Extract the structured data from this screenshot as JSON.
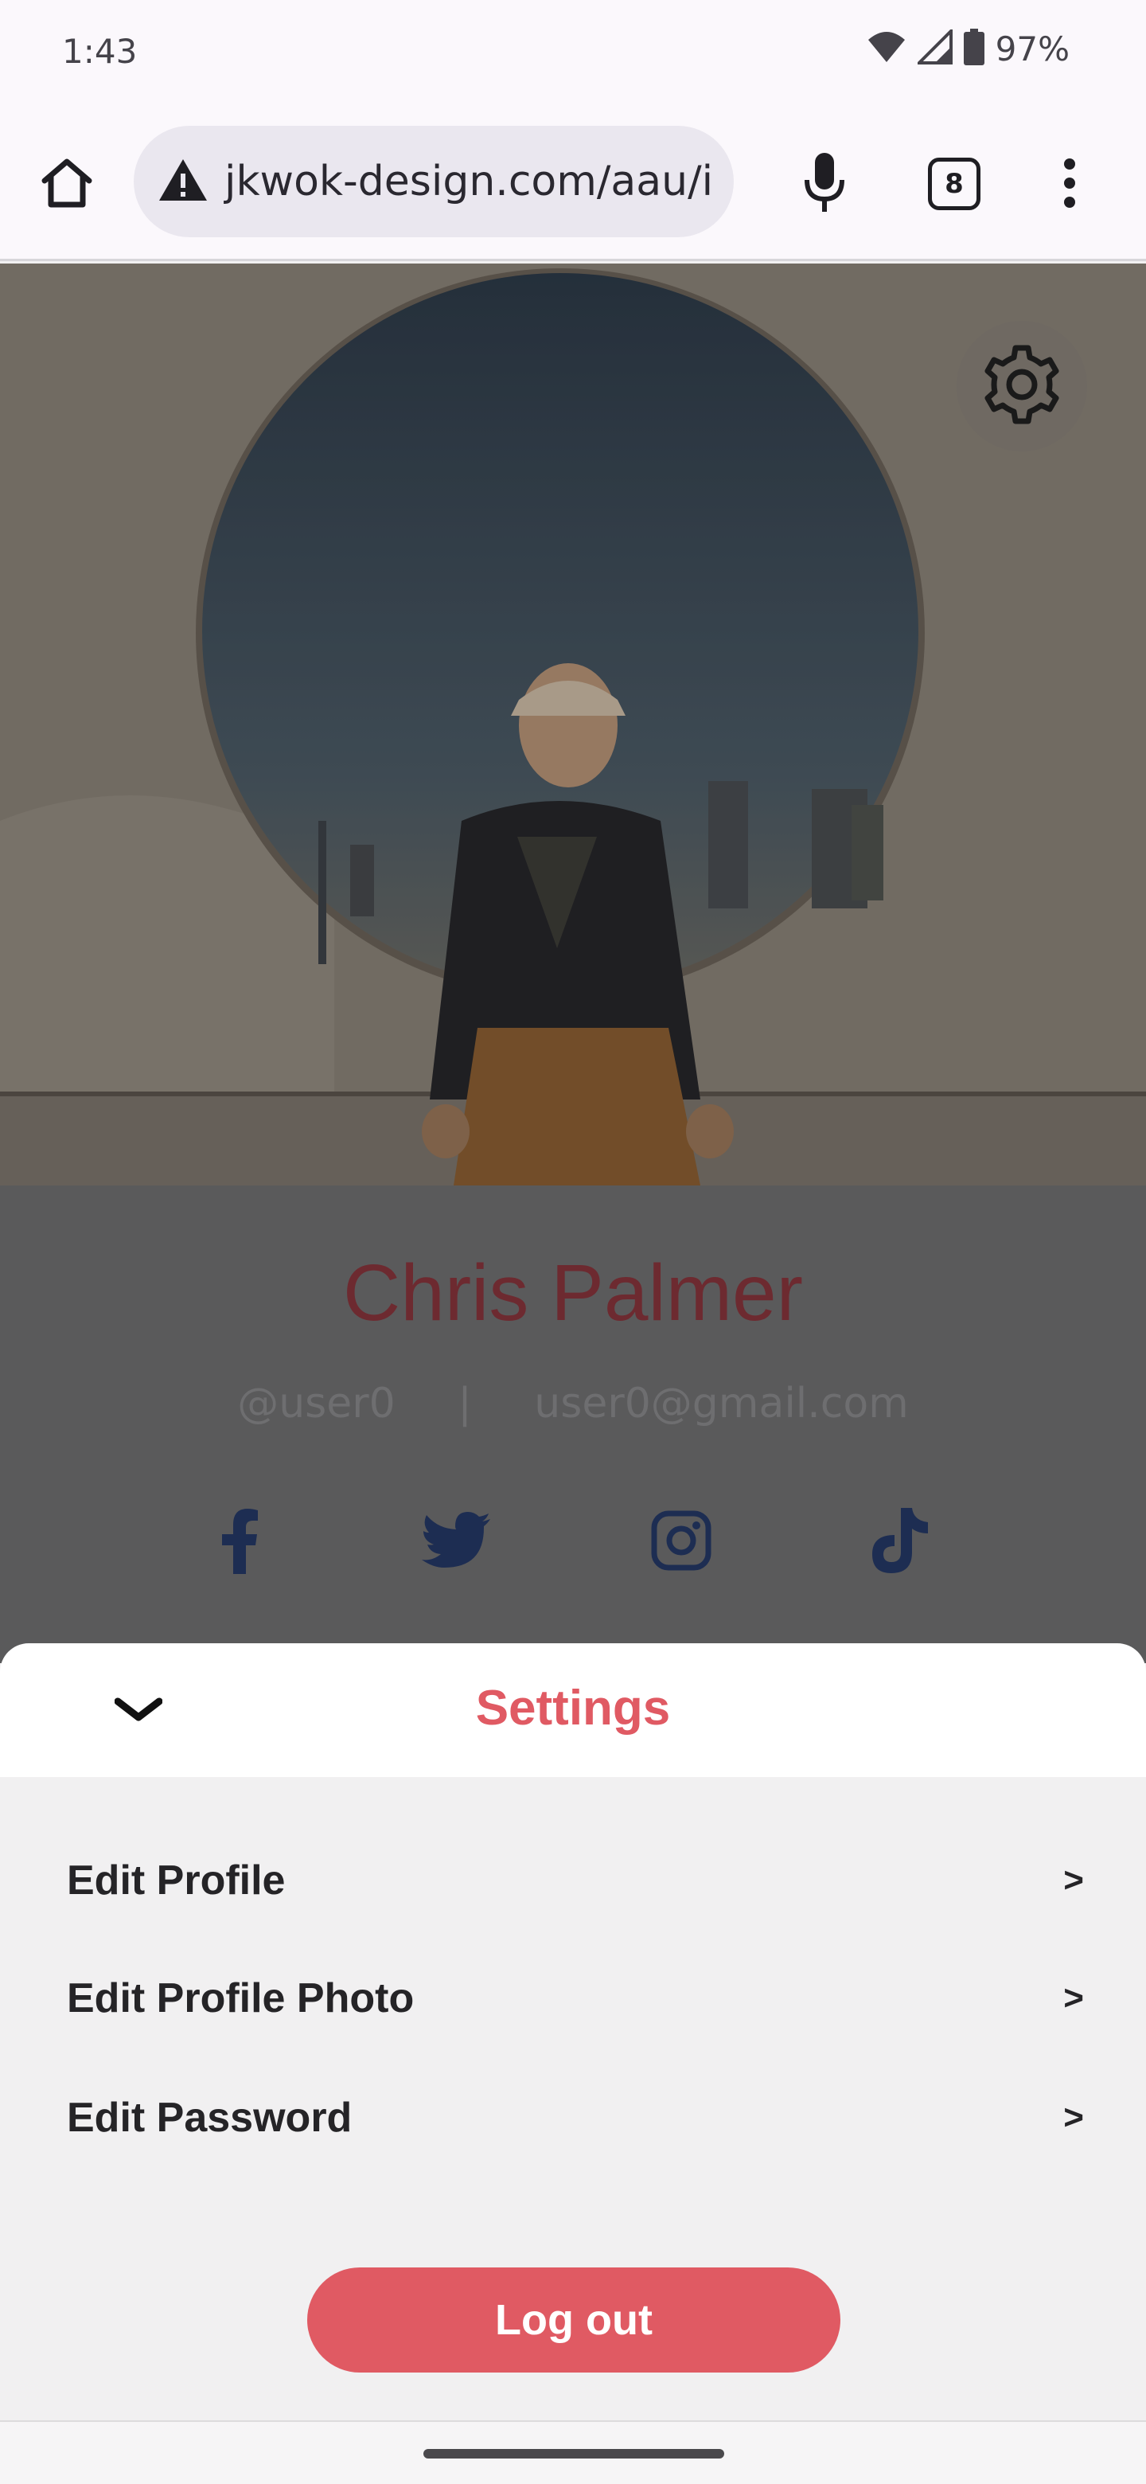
{
  "status_bar": {
    "time": "1:43",
    "battery": "97%",
    "icons": [
      "wifi-icon",
      "cell-signal-icon",
      "battery-icon"
    ]
  },
  "browser": {
    "url": "jkwok-design.com/aau/i",
    "tab_count": "8",
    "icons": [
      "home-icon",
      "warning-icon",
      "mic-icon",
      "tabs-icon",
      "more-vert-icon"
    ]
  },
  "profile": {
    "name": "Chris Palmer",
    "username": "@user0",
    "separator": "|",
    "email": "user0@gmail.com",
    "socials": [
      "facebook-icon",
      "twitter-icon",
      "instagram-icon",
      "tiktok-icon"
    ]
  },
  "sheet": {
    "title": "Settings",
    "items": [
      {
        "label": "Edit Profile",
        "arrow": ">"
      },
      {
        "label": "Edit Profile Photo",
        "arrow": ">"
      },
      {
        "label": "Edit Password",
        "arrow": ">"
      }
    ],
    "logout_label": "Log out"
  },
  "colors": {
    "accent": "#e05a63",
    "sheet_background": "#f1f0f1",
    "overlay": "#5a5a5b",
    "social_icon": "#1d2d52"
  }
}
